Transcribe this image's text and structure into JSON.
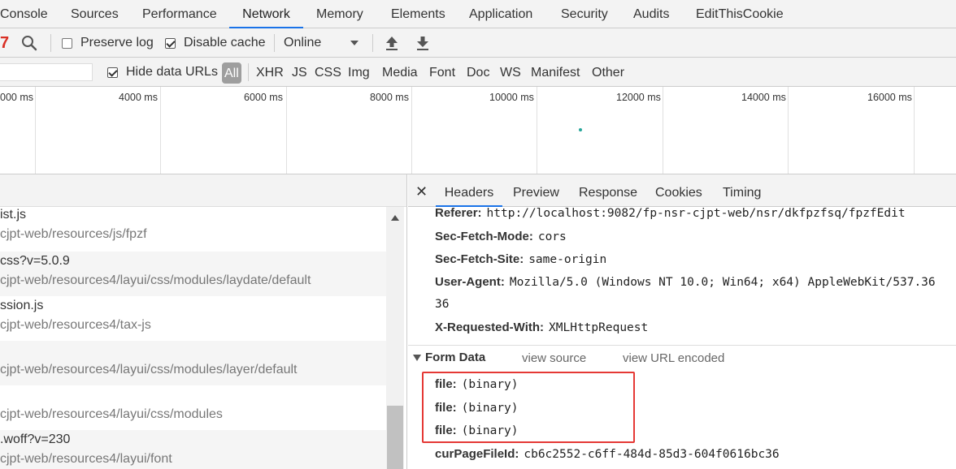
{
  "tabs": [
    {
      "label": "Console"
    },
    {
      "label": "Sources"
    },
    {
      "label": "Performance"
    },
    {
      "label": "Network"
    },
    {
      "label": "Memory"
    },
    {
      "label": "Elements"
    },
    {
      "label": "Application"
    },
    {
      "label": "Security"
    },
    {
      "label": "Audits"
    },
    {
      "label": "EditThisCookie"
    }
  ],
  "toolbar": {
    "filter_icon": "7",
    "search_icon": "search-icon",
    "preserve_log": "Preserve log",
    "preserve_log_checked": false,
    "disable_cache": "Disable cache",
    "disable_cache_checked": true,
    "throttling": "Online",
    "import_icon": "upload-icon",
    "export_icon": "download-icon"
  },
  "filterbar": {
    "filter_placeholder": "",
    "hide_data_urls": "Hide data URLs",
    "hide_data_urls_checked": true,
    "types": [
      "All",
      "XHR",
      "JS",
      "CSS",
      "Img",
      "Media",
      "Font",
      "Doc",
      "WS",
      "Manifest",
      "Other"
    ],
    "active_type": "All"
  },
  "overview": {
    "labels": [
      "000 ms",
      "4000 ms",
      "6000 ms",
      "8000 ms",
      "10000 ms",
      "12000 ms",
      "14000 ms",
      "16000 ms"
    ]
  },
  "requests": [
    {
      "name": "ist.js",
      "path": "cjpt-web/resources/js/fpzf"
    },
    {
      "name": "css?v=5.0.9",
      "path": "cjpt-web/resources4/layui/css/modules/laydate/default"
    },
    {
      "name": "ssion.js",
      "path": "cjpt-web/resources4/tax-js"
    },
    {
      "name": "",
      "path": "cjpt-web/resources4/layui/css/modules/layer/default"
    },
    {
      "name": "",
      "path": "cjpt-web/resources4/layui/css/modules"
    },
    {
      "name": ".woff?v=230",
      "path": "cjpt-web/resources4/layui/font"
    }
  ],
  "details": {
    "tabs": [
      "Headers",
      "Preview",
      "Response",
      "Cookies",
      "Timing"
    ],
    "active_tab": "Headers",
    "headers": [
      {
        "name": "Referer:",
        "value": "http://localhost:9082/fp-nsr-cjpt-web/nsr/dkfpzfsq/fpzfEdit"
      },
      {
        "name": "Sec-Fetch-Mode:",
        "value": "cors"
      },
      {
        "name": "Sec-Fetch-Site:",
        "value": "same-origin"
      },
      {
        "name": "User-Agent:",
        "value": "Mozilla/5.0 (Windows NT 10.0; Win64; x64) AppleWebKit/537.36"
      }
    ],
    "user_agent_continuation": "36",
    "x_requested_with": {
      "name": "X-Requested-With:",
      "value": "XMLHttpRequest"
    },
    "form_data": {
      "title": "Form Data",
      "view_source": "view source",
      "view_url_encoded": "view URL encoded",
      "fields": [
        {
          "name": "file:",
          "value": "(binary)"
        },
        {
          "name": "file:",
          "value": "(binary)"
        },
        {
          "name": "file:",
          "value": "(binary)"
        },
        {
          "name": "curPageFileId:",
          "value": "cb6c2552-c6ff-484d-85d3-604f0616bc36"
        }
      ]
    },
    "highlight_color": "#e53935"
  },
  "colors": {
    "accent": "#1a73e8",
    "highlight": "#e53935"
  }
}
